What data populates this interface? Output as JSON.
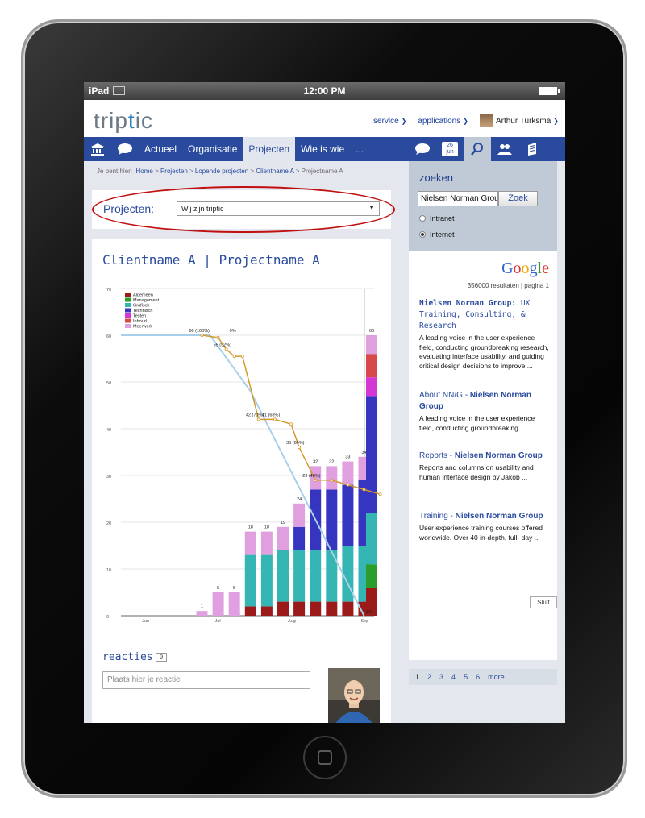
{
  "device": {
    "name": "iPad",
    "time": "12:00 PM"
  },
  "logo": {
    "text_a": "trip",
    "text_i": "t",
    "text_b": "ic",
    "full": "triptic"
  },
  "toplinks": {
    "service": "service",
    "applications": "applications",
    "user": "Arthur Turksma"
  },
  "nav": {
    "items": [
      {
        "label": "Actueel"
      },
      {
        "label": "Organisatie"
      },
      {
        "label": "Projecten"
      },
      {
        "label": "Wie is wie"
      },
      {
        "label": "..."
      }
    ],
    "calendar": {
      "day": "26",
      "month": "jun"
    }
  },
  "breadcrumb": {
    "prefix": "Je bent hier:",
    "crumbs": [
      "Home",
      "Projecten",
      "Lopende projecten",
      "Clientname A"
    ],
    "current": "Projectname A",
    "sep": ">"
  },
  "project_select": {
    "label": "Projecten:",
    "value": "Wij zijn triptic"
  },
  "content": {
    "title": "Clientname A | Projectname A"
  },
  "comments": {
    "title": "reacties",
    "count": "0",
    "placeholder": "Plaats hier je reactie"
  },
  "search": {
    "title": "zoeken",
    "query": "Nielsen Norman Group",
    "button": "Zoek",
    "options": [
      {
        "label": "Intranet",
        "selected": false
      },
      {
        "label": "Internet",
        "selected": true
      }
    ]
  },
  "results": {
    "engine": "Google",
    "count_text": "356000 resultaten | pagina 1",
    "items": [
      {
        "title_plain": "",
        "title_bold": "Nielsen Norman Group:",
        "title_tail": " UX Training, Consulting, & Research",
        "desc": "A leading voice in the user experience field, conducting groundbreaking research, evaluating interface usability, and guiding critical design decisions to improve ..."
      },
      {
        "title_plain": "About NN/G - ",
        "title_bold": "Nielsen Norman Group",
        "title_tail": "",
        "desc": "A leading voice in the user experience field, conducting groundbreaking ..."
      },
      {
        "title_plain": "Reports - ",
        "title_bold": "Nielsen Norman Group",
        "title_tail": "",
        "desc": "Reports and columns on usability and human interface design by Jakob ..."
      },
      {
        "title_plain": "Training - ",
        "title_bold": "Nielsen Norman Group",
        "title_tail": "",
        "desc": "User experience training courses offered worldwide. Over 40 in-depth, full- day ..."
      }
    ],
    "pages": [
      "1",
      "2",
      "3",
      "4",
      "5",
      "6",
      "more"
    ],
    "close": "Sluit"
  },
  "colors": {
    "brand_blue": "#294a9d",
    "highlight_red": "#c01010"
  },
  "chart_data": {
    "type": "bar",
    "ylim": [
      0,
      70
    ],
    "yticks": [
      0,
      10,
      20,
      30,
      40,
      50,
      60,
      70
    ],
    "x_labels": [
      {
        "label": "Jun",
        "week": 1.5
      },
      {
        "label": "Jul",
        "week": 6
      },
      {
        "label": "Aug",
        "week": 10.5
      },
      {
        "label": "Sep",
        "week": 15
      }
    ],
    "legend": [
      "Algemeen",
      "Management",
      "Grafisch",
      "Technisch",
      "Testen",
      "Inhoud",
      "Meerwerk"
    ],
    "legend_colors": [
      "#9b1b1b",
      "#2a9d2a",
      "#36b5b5",
      "#3535c0",
      "#d438d4",
      "#d94848",
      "#e0a0e0"
    ],
    "weeks": [
      {
        "week": 5,
        "total": 1,
        "stack": {
          "Meerwerk": 1
        }
      },
      {
        "week": 6,
        "total": 5,
        "stack": {
          "Meerwerk": 5
        }
      },
      {
        "week": 7,
        "total": 5,
        "stack": {
          "Meerwerk": 5
        }
      },
      {
        "week": 8,
        "total": 18,
        "stack": {
          "Algemeen": 2,
          "Grafisch": 11,
          "Meerwerk": 5
        }
      },
      {
        "week": 9,
        "total": 18,
        "stack": {
          "Algemeen": 2,
          "Grafisch": 11,
          "Meerwerk": 5
        }
      },
      {
        "week": 10,
        "total": 19,
        "stack": {
          "Algemeen": 3,
          "Grafisch": 11,
          "Meerwerk": 5
        }
      },
      {
        "week": 11,
        "total": 24,
        "stack": {
          "Algemeen": 3,
          "Grafisch": 11,
          "Technisch": 5,
          "Meerwerk": 5
        }
      },
      {
        "week": 12,
        "total": 32,
        "stack": {
          "Algemeen": 3,
          "Grafisch": 11,
          "Technisch": 13,
          "Meerwerk": 5
        }
      },
      {
        "week": 13,
        "total": 32,
        "stack": {
          "Algemeen": 3,
          "Grafisch": 11,
          "Technisch": 13,
          "Meerwerk": 5
        }
      },
      {
        "week": 14,
        "total": 33,
        "stack": {
          "Algemeen": 3,
          "Grafisch": 12,
          "Technisch": 13,
          "Meerwerk": 5
        }
      },
      {
        "week": 15,
        "total": 34,
        "stack": {
          "Algemeen": 3,
          "Grafisch": 12,
          "Technisch": 14,
          "Meerwerk": 5
        }
      }
    ],
    "total_bar": {
      "total": 60,
      "stack": {
        "Algemeen": 6,
        "Management": 5,
        "Grafisch": 11,
        "Technisch": 25,
        "Testen": 4,
        "Inhoud": 5,
        "Meerwerk": 4
      }
    },
    "ideal_line": [
      [
        0,
        60
      ],
      [
        5.5,
        60
      ],
      [
        8,
        48
      ],
      [
        15,
        0
      ]
    ],
    "actual_line": [
      {
        "week": 5,
        "value": 60,
        "label": "60 (100%)"
      },
      {
        "week": 6,
        "value": 59.5,
        "label": ""
      },
      {
        "week": 6.5,
        "value": 57,
        "label": "55 (92%)"
      },
      {
        "week": 7,
        "value": 55.5,
        "label": ""
      },
      {
        "week": 7.5,
        "value": 55.5,
        "label": ""
      },
      {
        "week": 8.5,
        "value": 42,
        "label": "42 (70%)"
      },
      {
        "week": 9.5,
        "value": 42,
        "label": "41 (68%)"
      },
      {
        "week": 10.5,
        "value": 41,
        "label": ""
      },
      {
        "week": 11,
        "value": 36,
        "label": "36 (60%)"
      },
      {
        "week": 12,
        "value": 29,
        "label": "29 (48%)"
      },
      {
        "week": 13,
        "value": 29,
        "label": ""
      },
      {
        "week": 14,
        "value": 28,
        "label": ""
      },
      {
        "week": 15,
        "value": 27,
        "label": ""
      },
      {
        "week": 16,
        "value": 26,
        "label": ""
      }
    ],
    "point_labels": [
      {
        "week": 6.8,
        "text": "0%"
      },
      {
        "week": 15.2,
        "text": "0%"
      }
    ]
  }
}
